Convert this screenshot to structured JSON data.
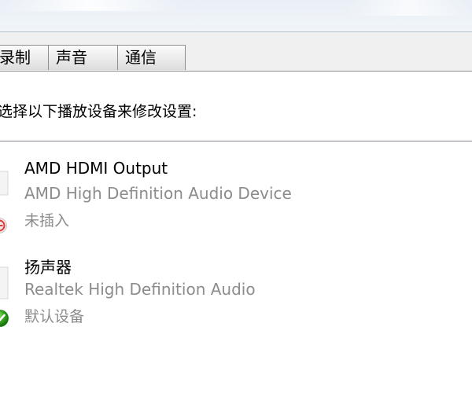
{
  "tabs": [
    {
      "label": "录制"
    },
    {
      "label": "声音"
    },
    {
      "label": "通信"
    }
  ],
  "instruction": "选择以下播放设备来修改设置:",
  "devices": [
    {
      "name": "AMD HDMI Output",
      "description": "AMD High Definition Audio Device",
      "status": "未插入",
      "status_icon": "unplugged-red-icon"
    },
    {
      "name": "扬声器",
      "description": "Realtek High Definition Audio",
      "status": "默认设备",
      "status_icon": "default-check-green-icon"
    }
  ],
  "colors": {
    "secondary_text": "#8c8c8c",
    "tab_border": "#8e8f8f",
    "status_ok": "#2f9e2f",
    "status_unplugged": "#d04040"
  }
}
